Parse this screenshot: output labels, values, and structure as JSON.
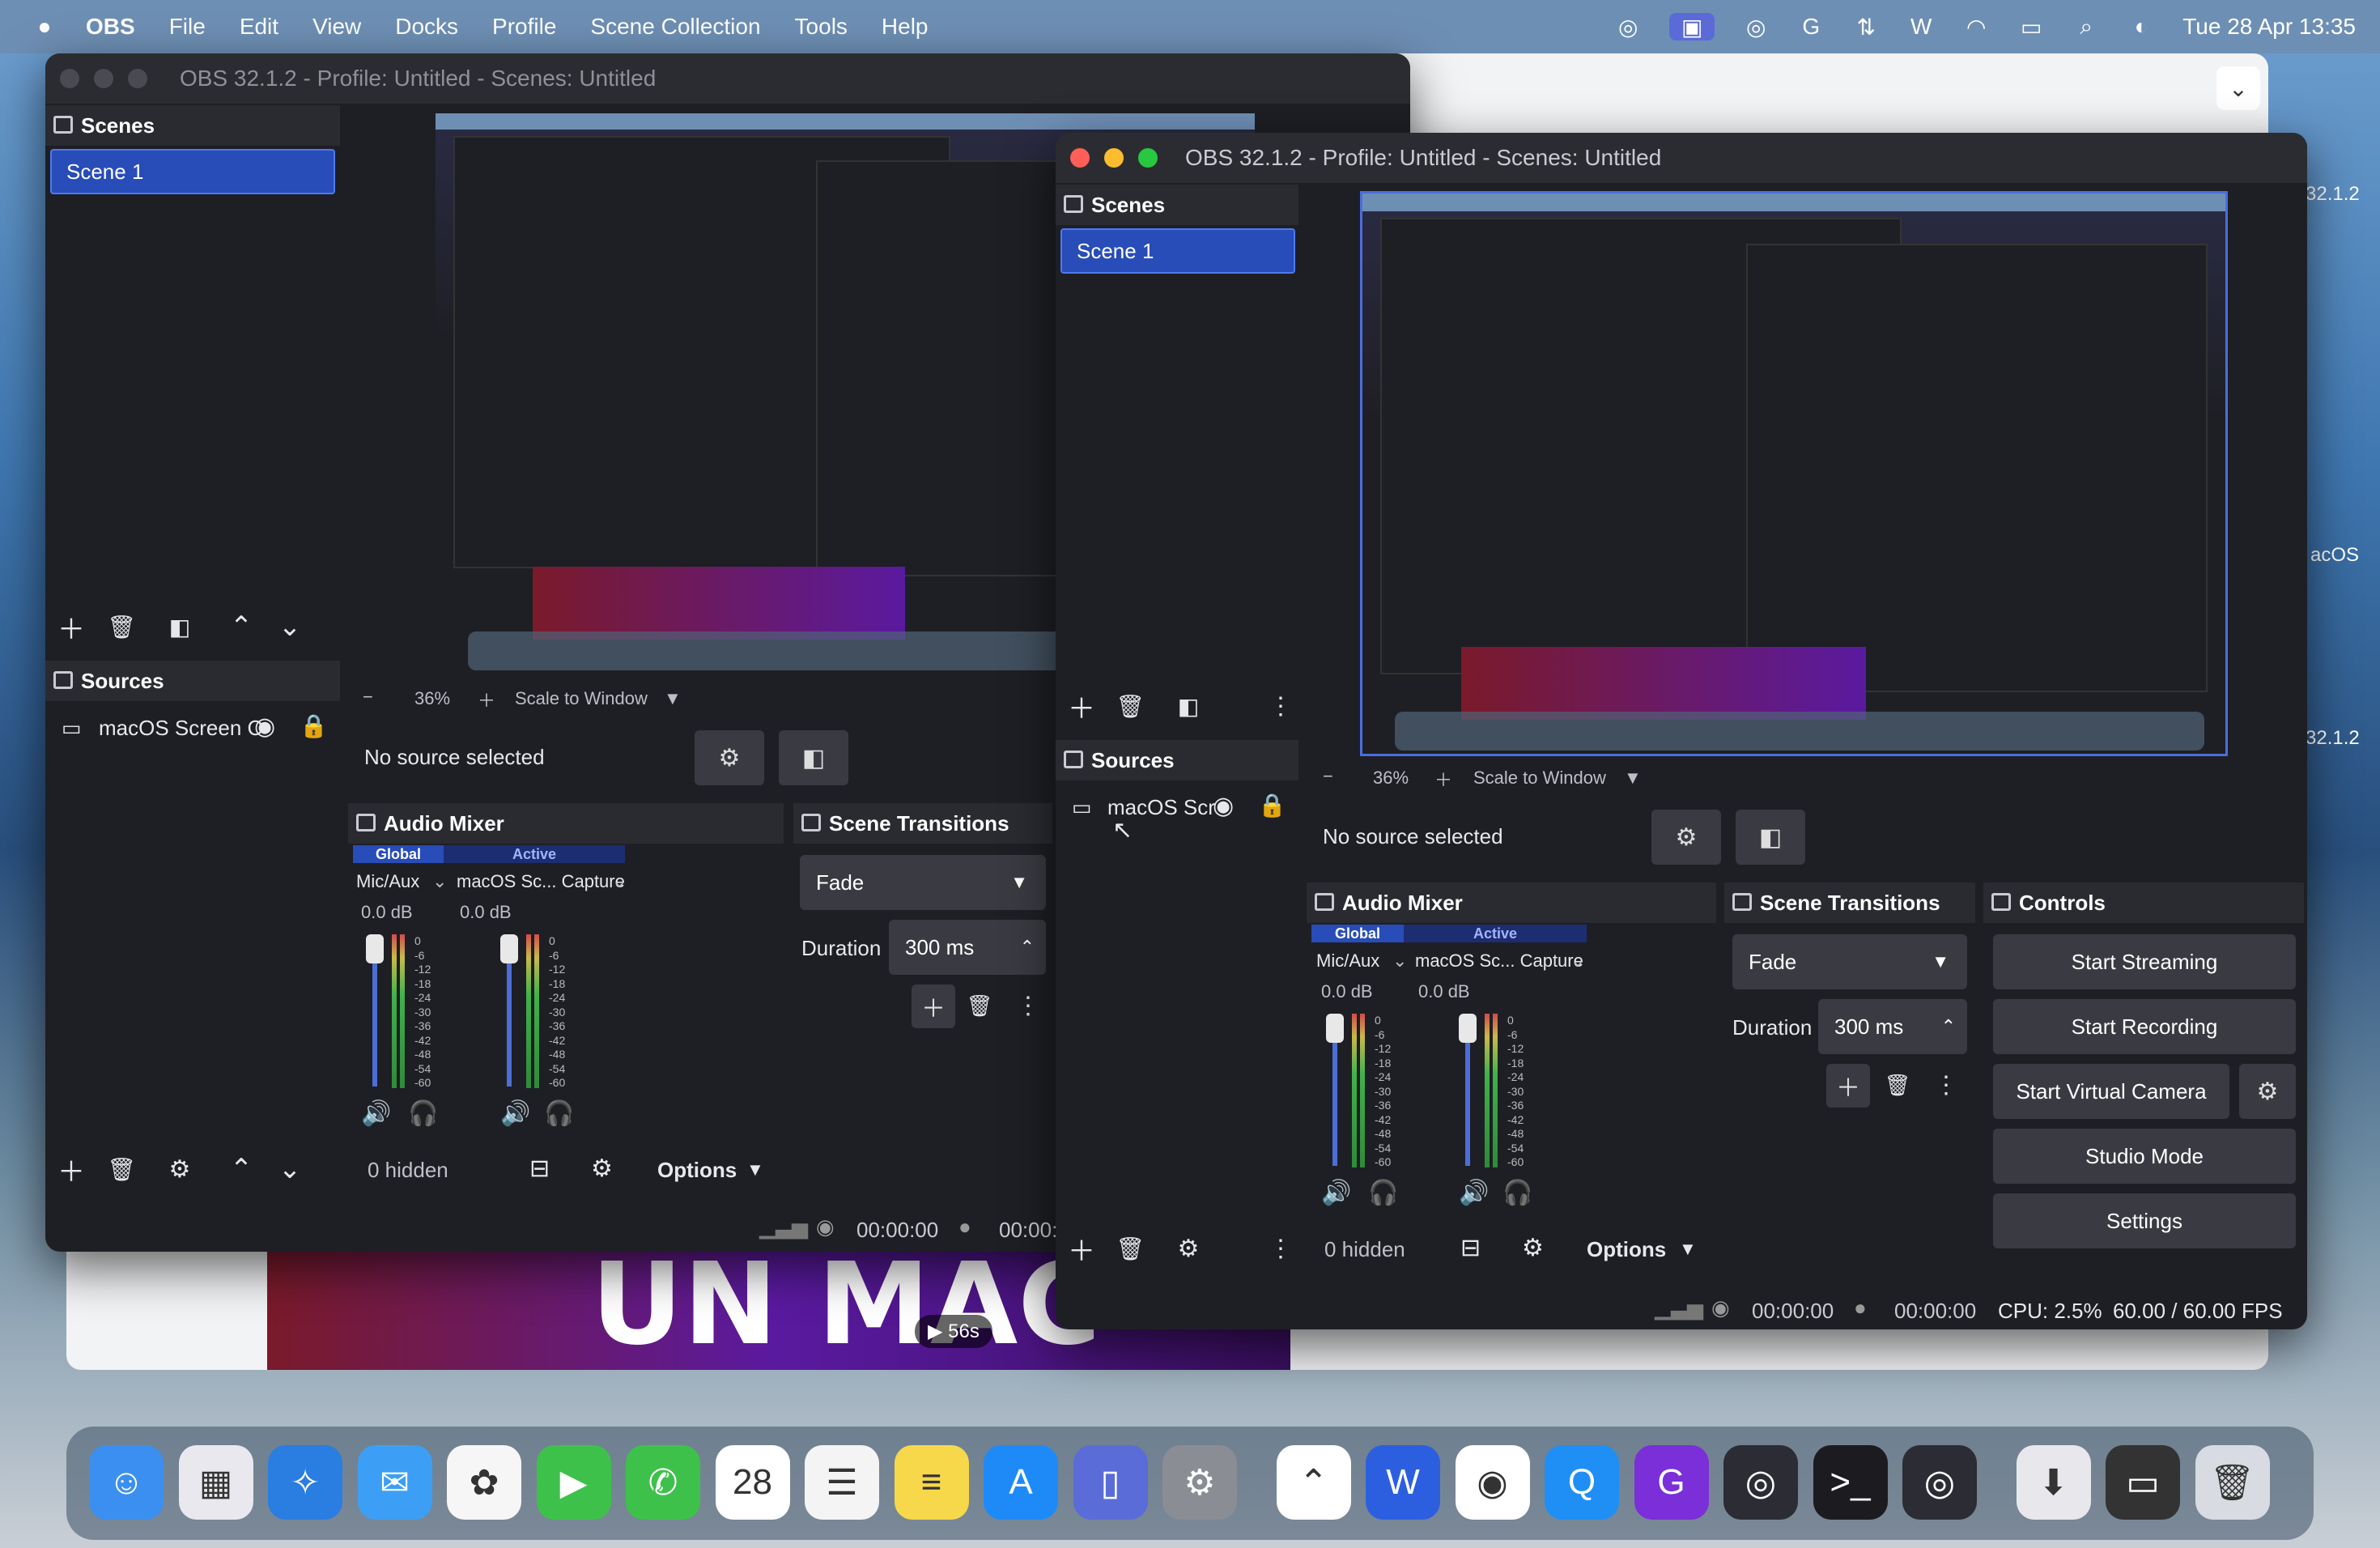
{
  "menubar": {
    "apple": "",
    "app": "OBS",
    "items": [
      "File",
      "Edit",
      "View",
      "Docks",
      "Profile",
      "Scene Collection",
      "Tools",
      "Help"
    ],
    "clock": "Tue 28 Apr  13:35"
  },
  "back_window": {
    "title": "OBS 32.1.2 - Profile: Untitled - Scenes: Untitled",
    "scenes_title": "Scenes",
    "scene_item": "Scene 1",
    "sources_title": "Sources",
    "source_item": "macOS Screen C",
    "no_source": "No source selected",
    "zoom": "36%",
    "scale": "Scale to Window",
    "audio_title": "Audio Mixer",
    "tab_global": "Global",
    "tab_active": "Active",
    "ch1": "Mic/Aux",
    "ch2": "macOS Sc... Capture",
    "db1": "0.0 dB",
    "db2": "0.0 dB",
    "hidden": "0 hidden",
    "options": "Options",
    "transitions_title": "Scene Transitions",
    "fade": "Fade",
    "duration_label": "Duration",
    "duration_value": "300 ms",
    "time1": "00:00:00",
    "time2": "00:00:"
  },
  "front_window": {
    "title": "OBS 32.1.2 - Profile: Untitled - Scenes: Untitled",
    "scenes_title": "Scenes",
    "scene_item": "Scene 1",
    "sources_title": "Sources",
    "source_item": "macOS Scr",
    "no_source": "No source selected",
    "zoom": "36%",
    "scale": "Scale to Window",
    "audio_title": "Audio Mixer",
    "tab_global": "Global",
    "tab_active": "Active",
    "ch1": "Mic/Aux",
    "ch2": "macOS Sc... Capture",
    "db1": "0.0 dB",
    "db2": "0.0 dB",
    "hidden": "0 hidden",
    "options": "Options",
    "transitions_title": "Scene Transitions",
    "fade": "Fade",
    "duration_label": "Duration",
    "duration_value": "300 ms",
    "controls_title": "Controls",
    "start_streaming": "Start Streaming",
    "start_recording": "Start Recording",
    "start_virtual_camera": "Start Virtual Camera",
    "studio_mode": "Studio Mode",
    "settings": "Settings",
    "time1": "00:00:00",
    "time2": "00:00:00",
    "cpu": "CPU: 2.5%",
    "fps": "60.00 / 60.00 FPS"
  },
  "meter_ticks": [
    "0",
    "-6",
    "-12",
    "-18",
    "-24",
    "-30",
    "-36",
    "-42",
    "-48",
    "-54",
    "-60"
  ],
  "background": {
    "video_text": "UN MAC",
    "badge": "▶ 56s",
    "side_version": "32.1.2",
    "side_version2": "32.1.2",
    "side_macos": "acOS"
  },
  "dock_icons": [
    {
      "name": "finder",
      "color": "#3b8ff0",
      "glyph": "☺"
    },
    {
      "name": "launchpad",
      "color": "#e8e8ee",
      "glyph": "▦"
    },
    {
      "name": "safari",
      "color": "#2a7de1",
      "glyph": "✧"
    },
    {
      "name": "mail",
      "color": "#3c9ff5",
      "glyph": "✉"
    },
    {
      "name": "photos",
      "color": "#f6f6f6",
      "glyph": "✿"
    },
    {
      "name": "facetime",
      "color": "#3ec14b",
      "glyph": "▶"
    },
    {
      "name": "phone",
      "color": "#3ec14b",
      "glyph": "✆"
    },
    {
      "name": "calendar",
      "color": "#ffffff",
      "glyph": "28"
    },
    {
      "name": "reminders",
      "color": "#f4f4f4",
      "glyph": "☰"
    },
    {
      "name": "notes",
      "color": "#f7d84a",
      "glyph": "≡"
    },
    {
      "name": "app-store",
      "color": "#1e8af7",
      "glyph": "A"
    },
    {
      "name": "iphone-mirroring",
      "color": "#5a6cd8",
      "glyph": "▯"
    },
    {
      "name": "system-settings",
      "color": "#8a8d94",
      "glyph": "⚙"
    },
    {
      "name": "clickup",
      "color": "#ffffff",
      "glyph": "⌃"
    },
    {
      "name": "word",
      "color": "#2c5fe0",
      "glyph": "W"
    },
    {
      "name": "chrome",
      "color": "#ffffff",
      "glyph": "◉"
    },
    {
      "name": "quick",
      "color": "#1f8ff5",
      "glyph": "Q"
    },
    {
      "name": "g-app",
      "color": "#7a2fd8",
      "glyph": "G"
    },
    {
      "name": "obs",
      "color": "#2c2c34",
      "glyph": "◎"
    },
    {
      "name": "terminal",
      "color": "#1c1c20",
      "glyph": ">_"
    },
    {
      "name": "obs-2",
      "color": "#2c2c34",
      "glyph": "◎"
    },
    {
      "name": "downloads",
      "color": "#e8e8ec",
      "glyph": "⬇"
    },
    {
      "name": "screens",
      "color": "#333",
      "glyph": "▭"
    },
    {
      "name": "trash",
      "color": "#d8dce2",
      "glyph": "🗑"
    }
  ]
}
